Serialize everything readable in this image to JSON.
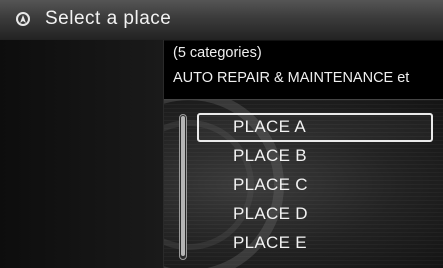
{
  "header": {
    "title": "Select a place",
    "icon": "navigation-icon"
  },
  "info": {
    "count": "(5 categories)",
    "categories": "AUTO REPAIR & MAINTENANCE et"
  },
  "list": {
    "items": [
      {
        "label": "PLACE A",
        "selected": true
      },
      {
        "label": "PLACE B",
        "selected": false
      },
      {
        "label": "PLACE C",
        "selected": false
      },
      {
        "label": "PLACE D",
        "selected": false
      },
      {
        "label": "PLACE E",
        "selected": false
      }
    ]
  },
  "colors": {
    "background": "#000000",
    "header": "#3b3b3b",
    "text": "#f2f2f2",
    "selection_border": "#eaeaea"
  }
}
